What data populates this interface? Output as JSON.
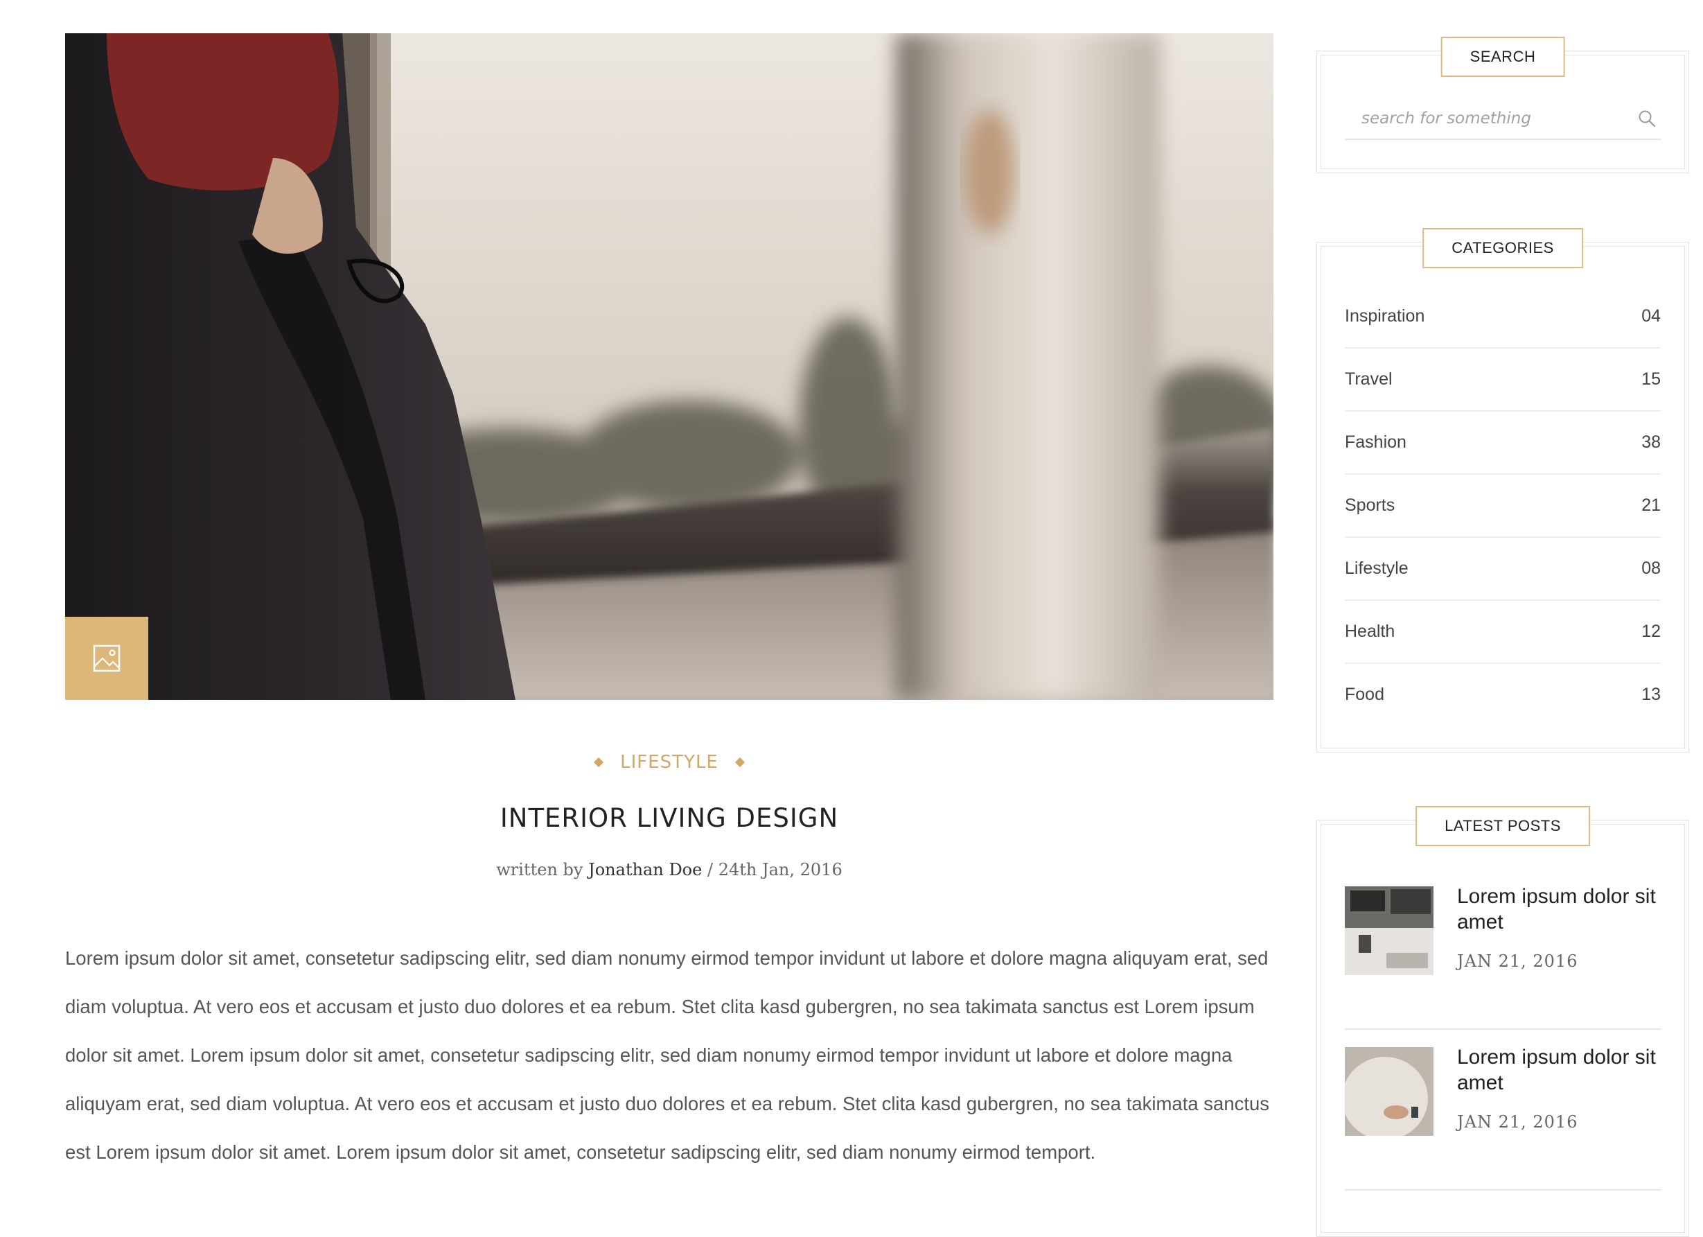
{
  "post": {
    "category": "LIFESTYLE",
    "title": "INTERIOR LIVING DESIGN",
    "written_by": "written by",
    "author": "Jonathan Doe",
    "separator": "/",
    "date": "24th Jan, 2016",
    "body": "Lorem ipsum dolor sit amet, consetetur sadipscing elitr, sed diam nonumy eirmod tempor invidunt ut labore et dolore magna aliquyam erat, sed diam voluptua. At vero eos et accusam et justo duo dolores et ea rebum. Stet clita kasd gubergren, no sea takimata sanctus est Lorem ipsum dolor sit amet. Lorem ipsum dolor sit amet, consetetur sadipscing elitr, sed diam nonumy eirmod tempor invidunt ut labore et dolore magna aliquyam erat, sed diam voluptua. At vero eos et accusam et justo duo dolores et ea rebum. Stet clita kasd gubergren, no sea takimata sanctus est Lorem ipsum dolor sit amet. Lorem ipsum dolor sit amet, consetetur sadipscing elitr, sed diam nonumy eirmod temport.",
    "format_icon": "image-icon"
  },
  "sidebar": {
    "search": {
      "title": "SEARCH",
      "placeholder": "search for something",
      "icon": "search-icon"
    },
    "categories": {
      "title": "CATEGORIES",
      "items": [
        {
          "label": "Inspiration",
          "count": "04"
        },
        {
          "label": "Travel",
          "count": "15"
        },
        {
          "label": "Fashion",
          "count": "38"
        },
        {
          "label": "Sports",
          "count": "21"
        },
        {
          "label": "Lifestyle",
          "count": "08"
        },
        {
          "label": "Health",
          "count": "12"
        },
        {
          "label": "Food",
          "count": "13"
        }
      ]
    },
    "latest_posts": {
      "title": "LATEST POSTS",
      "items": [
        {
          "title": "Lorem ipsum dolor sit amet",
          "date": "JAN 21, 2016"
        },
        {
          "title": "Lorem ipsum dolor sit amet",
          "date": "JAN 21, 2016"
        }
      ]
    }
  },
  "colors": {
    "accent": "#d1a765",
    "badge": "#ddb779",
    "border": "#e3e3e3",
    "text": "#333333"
  }
}
